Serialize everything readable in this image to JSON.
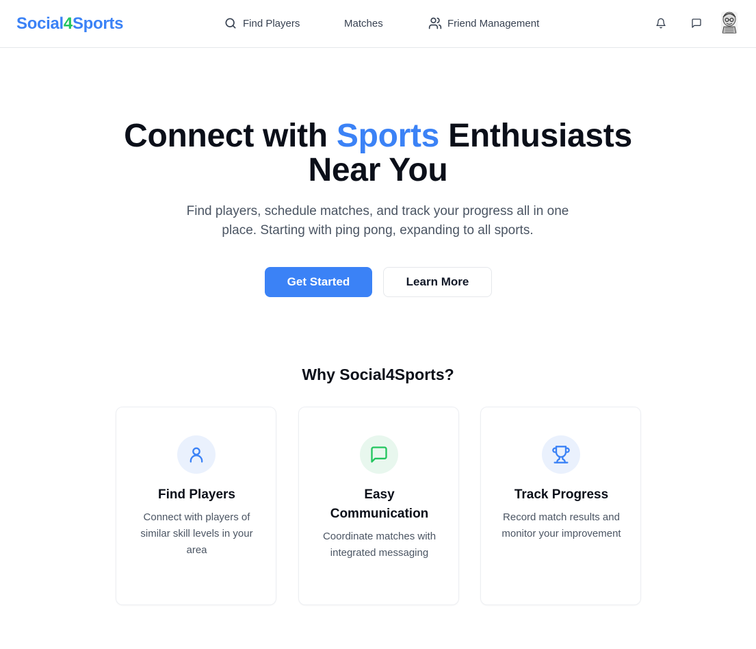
{
  "brand": {
    "part1": "Social",
    "part2": "4",
    "part3": "Sports",
    "color_blue": "#3b82f6",
    "color_green": "#22c55e"
  },
  "nav": {
    "links": [
      {
        "label": "Find Players",
        "icon": "search-icon"
      },
      {
        "label": "Matches",
        "icon": ""
      },
      {
        "label": "Friend Management",
        "icon": "users-icon"
      }
    ],
    "icons": [
      "bell-icon",
      "message-icon"
    ],
    "avatar": "avatar"
  },
  "hero": {
    "title_before": "Connect with ",
    "title_accent": "Sports",
    "title_after": " Enthusiasts",
    "title_line2": "Near You",
    "subtitle": "Find players, schedule matches, and track your progress all in one place. Starting with ping pong, expanding to all sports.",
    "primary_button": "Get Started",
    "secondary_button": "Learn More",
    "accent_color": "#3b82f6"
  },
  "features": {
    "title": "Why Social4Sports?",
    "cards": [
      {
        "title": "Find Players",
        "description": "Connect with players of similar skill levels in your area",
        "icon": "user-icon",
        "icon_color": "#3b82f6",
        "icon_bg": "#eaf1fd"
      },
      {
        "title": "Easy Communication",
        "description": "Coordinate matches with integrated messaging",
        "icon": "message-square-icon",
        "icon_color": "#22c55e",
        "icon_bg": "#e8f7ee"
      },
      {
        "title": "Track Progress",
        "description": "Record match results and monitor your improvement",
        "icon": "trophy-icon",
        "icon_color": "#3b82f6",
        "icon_bg": "#eaf1fd"
      }
    ]
  }
}
